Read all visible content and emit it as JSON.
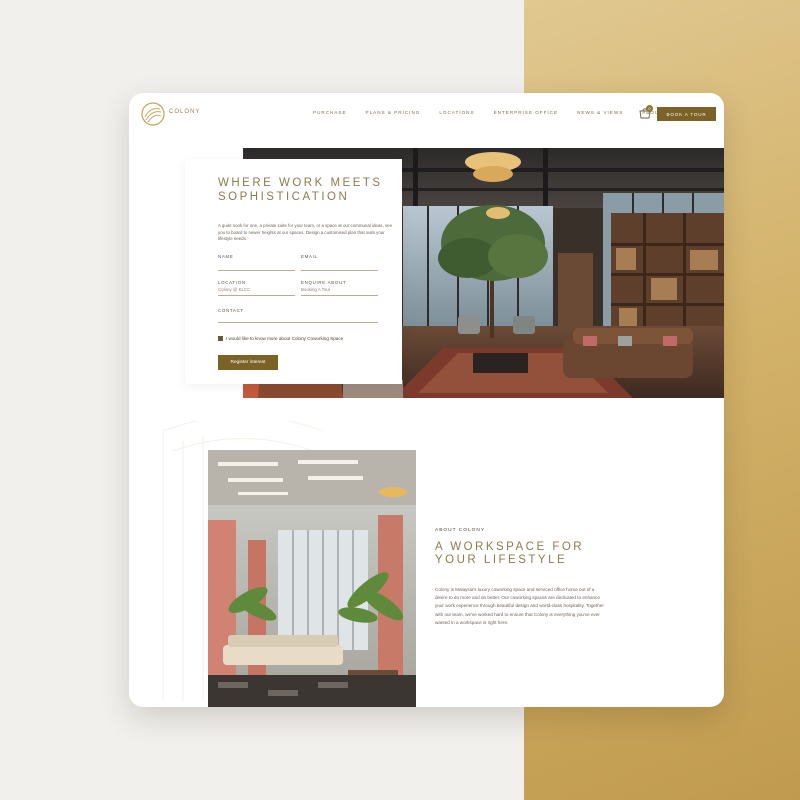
{
  "colors": {
    "accent_gold": "#7b6227",
    "title_gold": "#8e7a4c",
    "background_right": "#d3b26a",
    "background_left": "#f1f0ed"
  },
  "nav": {
    "logo_text": "COLONY",
    "links": [
      "PURCHASE",
      "PLANS & PRICING",
      "LOCATIONS",
      "ENTERPRISE OFFICE",
      "NEWS & VIEWS",
      "ABOUT"
    ],
    "cart_count": "0",
    "cart_icon": "shopping-bag-icon",
    "book_label": "BOOK A TOUR"
  },
  "hero": {
    "title": "WHERE WORK MEETS SOPHISTICATION",
    "description": "A quiet nook for one, a private suite for your team, or a space at our communal ideas, see you to board to newer heights at our spaces. Design a customised plan that suits your lifestyle needs.",
    "form": {
      "name_label": "NAME",
      "email_label": "EMAIL",
      "location_label": "LOCATION",
      "location_value": "Colony @ KLCC",
      "enquire_label": "ENQUIRE ABOUT",
      "enquire_value": "Booking A Tour",
      "contact_label": "CONTACT",
      "checkbox_label": "I would like to know more about Colony Coworking Space",
      "submit_label": "Register interest"
    }
  },
  "about": {
    "eyebrow": "ABOUT COLONY",
    "title": "A WORKSPACE FOR YOUR LIFESTYLE",
    "text": "Colony is Malaysia's luxury coworking space and serviced office home out of a desire to do more and do better. Our coworking spaces are dedicated to enhance your work experience through beautiful design and world-class hospitality. Together with our team, we've worked hard to ensure that Colony is everything you've ever wanted in a workspace is right here."
  }
}
